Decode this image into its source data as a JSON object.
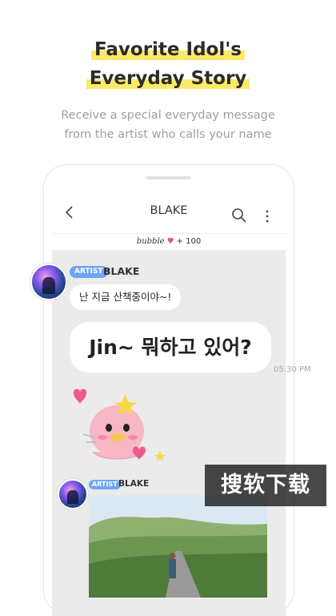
{
  "headline": {
    "line1": "Favorite Idol's",
    "line2": "Everyday Story",
    "highlight_color": "#fbe96a"
  },
  "subtitle": {
    "line1": "Receive a special everyday message",
    "line2": "from the artist who calls your name"
  },
  "app": {
    "title": "BLAKE",
    "bubble_brand": "bubble",
    "bubble_count": "+ 100",
    "icons": [
      "back-arrow-icon",
      "search-icon",
      "more-vertical-icon"
    ]
  },
  "messages": [
    {
      "badge": "ARTIST",
      "name": "BLAKE",
      "text": "난 지금 산책중이야~!"
    },
    {
      "text": "Jin~ 뭐하고 있어?",
      "time": "05:30 PM"
    }
  ],
  "second_message": {
    "badge": "ARTIST",
    "name": "BLAKE",
    "content": "photo"
  },
  "watermark": "搜软下载",
  "colors": {
    "badge": "#6ea6f3",
    "heart": "#e84e86",
    "chat_bg": "#ebebeb"
  }
}
